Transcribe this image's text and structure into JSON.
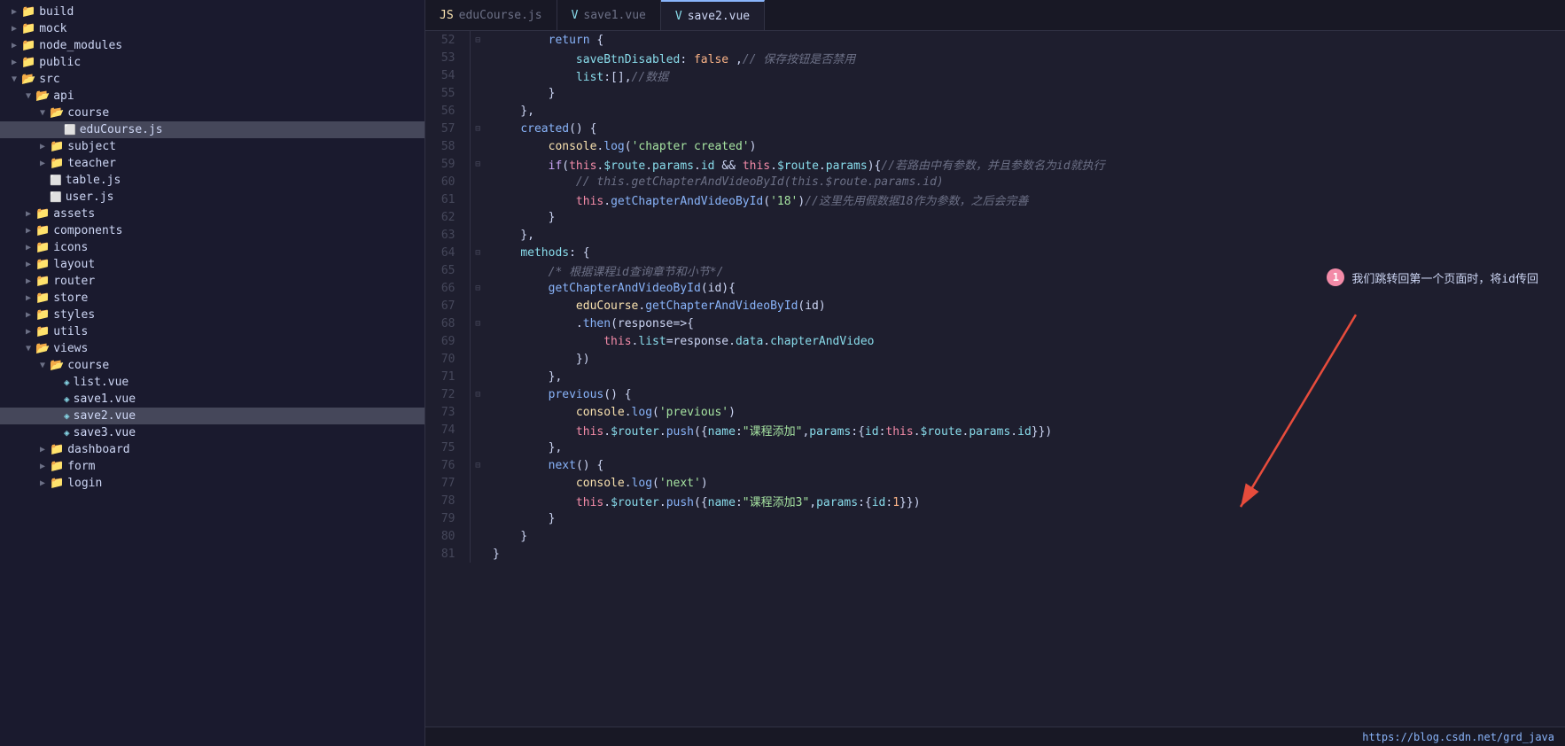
{
  "sidebar": {
    "items": [
      {
        "id": "build",
        "label": "build",
        "type": "folder",
        "level": 0,
        "expanded": false
      },
      {
        "id": "mock",
        "label": "mock",
        "type": "folder",
        "level": 0,
        "expanded": false
      },
      {
        "id": "node_modules",
        "label": "node_modules",
        "type": "folder",
        "level": 0,
        "expanded": false
      },
      {
        "id": "public",
        "label": "public",
        "type": "folder",
        "level": 0,
        "expanded": false
      },
      {
        "id": "src",
        "label": "src",
        "type": "folder",
        "level": 0,
        "expanded": true
      },
      {
        "id": "api",
        "label": "api",
        "type": "folder",
        "level": 1,
        "expanded": true
      },
      {
        "id": "course",
        "label": "course",
        "type": "folder",
        "level": 2,
        "expanded": true
      },
      {
        "id": "eduCourse.js",
        "label": "eduCourse.js",
        "type": "file-js",
        "level": 3,
        "expanded": false,
        "active": true
      },
      {
        "id": "subject",
        "label": "subject",
        "type": "folder",
        "level": 2,
        "expanded": false
      },
      {
        "id": "teacher",
        "label": "teacher",
        "type": "folder",
        "level": 2,
        "expanded": false
      },
      {
        "id": "table.js",
        "label": "table.js",
        "type": "file-js",
        "level": 2,
        "expanded": false
      },
      {
        "id": "user.js",
        "label": "user.js",
        "type": "file-js",
        "level": 2,
        "expanded": false
      },
      {
        "id": "assets",
        "label": "assets",
        "type": "folder",
        "level": 1,
        "expanded": false
      },
      {
        "id": "components",
        "label": "components",
        "type": "folder",
        "level": 1,
        "expanded": false
      },
      {
        "id": "icons",
        "label": "icons",
        "type": "folder",
        "level": 1,
        "expanded": false
      },
      {
        "id": "layout",
        "label": "layout",
        "type": "folder",
        "level": 1,
        "expanded": false
      },
      {
        "id": "router",
        "label": "router",
        "type": "folder",
        "level": 1,
        "expanded": false
      },
      {
        "id": "store",
        "label": "store",
        "type": "folder",
        "level": 1,
        "expanded": false
      },
      {
        "id": "styles",
        "label": "styles",
        "type": "folder",
        "level": 1,
        "expanded": false
      },
      {
        "id": "utils",
        "label": "utils",
        "type": "folder",
        "level": 1,
        "expanded": false
      },
      {
        "id": "views",
        "label": "views",
        "type": "folder",
        "level": 1,
        "expanded": true
      },
      {
        "id": "views-course",
        "label": "course",
        "type": "folder",
        "level": 2,
        "expanded": true
      },
      {
        "id": "list.vue",
        "label": "list.vue",
        "type": "file-vue",
        "level": 3,
        "expanded": false
      },
      {
        "id": "save1.vue",
        "label": "save1.vue",
        "type": "file-vue",
        "level": 3,
        "expanded": false
      },
      {
        "id": "save2.vue",
        "label": "save2.vue",
        "type": "file-vue",
        "level": 3,
        "expanded": false,
        "active": true
      },
      {
        "id": "save3.vue",
        "label": "save3.vue",
        "type": "file-vue",
        "level": 3,
        "expanded": false
      },
      {
        "id": "dashboard",
        "label": "dashboard",
        "type": "folder",
        "level": 2,
        "expanded": false
      },
      {
        "id": "form",
        "label": "form",
        "type": "folder",
        "level": 2,
        "expanded": false
      },
      {
        "id": "login",
        "label": "login",
        "type": "folder",
        "level": 2,
        "expanded": false
      }
    ]
  },
  "tabs": [
    {
      "id": "eduCourse",
      "label": "eduCourse.js",
      "type": "js",
      "active": false
    },
    {
      "id": "save1",
      "label": "save1.vue",
      "type": "vue",
      "active": false
    },
    {
      "id": "save2",
      "label": "save2.vue",
      "type": "vue",
      "active": true
    }
  ],
  "annotation": {
    "badge": "1",
    "text": "我们跳转回第一个页面时，将id传回"
  },
  "status_bar": {
    "url": "https://blog.csdn.net/grd_java"
  },
  "code_lines": [
    {
      "num": 52,
      "foldable": true,
      "content": "        return {"
    },
    {
      "num": 53,
      "foldable": false,
      "content": "            saveBtnDisabled: false ,// 保存按钮是否禁用"
    },
    {
      "num": 54,
      "foldable": false,
      "content": "            list:[],//数据"
    },
    {
      "num": 55,
      "foldable": false,
      "content": "        }"
    },
    {
      "num": 56,
      "foldable": false,
      "content": "    },"
    },
    {
      "num": 57,
      "foldable": true,
      "content": "    created() {"
    },
    {
      "num": 58,
      "foldable": false,
      "content": "        console.log('chapter created')"
    },
    {
      "num": 59,
      "foldable": true,
      "content": "        if(this.$route.params.id && this.$route.params){//若路由中有参数，并且参数名为id就执行"
    },
    {
      "num": 60,
      "foldable": false,
      "content": "            // this.getChapterAndVideoById(this.$route.params.id)"
    },
    {
      "num": 61,
      "foldable": false,
      "content": "            this.getChapterAndVideoById('18')//这里先用假数据18作为参数，之后会完善"
    },
    {
      "num": 62,
      "foldable": false,
      "content": "        }"
    },
    {
      "num": 63,
      "foldable": false,
      "content": "    },"
    },
    {
      "num": 64,
      "foldable": true,
      "content": "    methods: {"
    },
    {
      "num": 65,
      "foldable": false,
      "content": "        /* 根据课程id查询章节和小节*/"
    },
    {
      "num": 66,
      "foldable": true,
      "content": "        getChapterAndVideoById(id){"
    },
    {
      "num": 67,
      "foldable": false,
      "content": "            eduCourse.getChapterAndVideoById(id)"
    },
    {
      "num": 68,
      "foldable": true,
      "content": "            .then(response=>{"
    },
    {
      "num": 69,
      "foldable": false,
      "content": "                this.list=response.data.chapterAndVideo"
    },
    {
      "num": 70,
      "foldable": false,
      "content": "            })"
    },
    {
      "num": 71,
      "foldable": false,
      "content": "        },"
    },
    {
      "num": 72,
      "foldable": true,
      "content": "        previous() {"
    },
    {
      "num": 73,
      "foldable": false,
      "content": "            console.log('previous')"
    },
    {
      "num": 74,
      "foldable": false,
      "content": "            this.$router.push({name:\"课程添加\",params:{id:this.$route.params.id}})"
    },
    {
      "num": 75,
      "foldable": false,
      "content": "        },"
    },
    {
      "num": 76,
      "foldable": true,
      "content": "        next() {"
    },
    {
      "num": 77,
      "foldable": false,
      "content": "            console.log('next')"
    },
    {
      "num": 78,
      "foldable": false,
      "content": "            this.$router.push({name:\"课程添加3\",params:{id:1}})"
    },
    {
      "num": 79,
      "foldable": false,
      "content": "        }"
    },
    {
      "num": 80,
      "foldable": false,
      "content": "    }"
    },
    {
      "num": 81,
      "foldable": false,
      "content": "}"
    }
  ]
}
